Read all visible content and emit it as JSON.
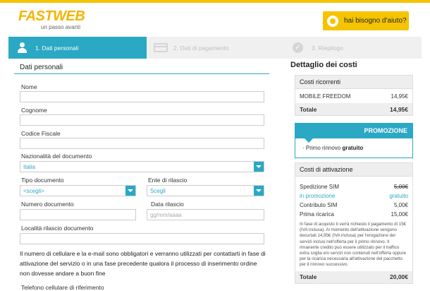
{
  "header": {
    "logo": "FASTWEB",
    "tagline": "un passo avanti",
    "help_label": "hai bisogno d'aiuto?"
  },
  "steps": [
    {
      "label": "1. Dati personali"
    },
    {
      "label": "2. Dati di pagamento"
    },
    {
      "label": "3. Riepilogo"
    }
  ],
  "form": {
    "section_title": "Dati personali",
    "nome_label": "Nome",
    "cognome_label": "Cognome",
    "codice_fiscale_label": "Codice Fiscale",
    "nazionalita_label": "Nazionalità del documento",
    "nazionalita_value": "Italia",
    "tipo_documento_label": "Tipo documento",
    "tipo_documento_value": "<scegli>",
    "ente_label": "Ente di rilascio",
    "ente_value": "Scegli",
    "numero_documento_label": "Numero documento",
    "data_rilascio_label": "Data rilascio",
    "data_rilascio_placeholder": "gg/mm/aaaa",
    "localita_label": "Località rilascio documento",
    "notice": "Il numero di cellulare e la e-mail sono obbligatori e verranno utilizzati per contattarti in fase di attivazione del servizio o in una fase precedente qualora il processo di inserimento ordine non dovesse andare a buon fine",
    "telefono_label": "Telefono cellulare di riferimento"
  },
  "sidebar": {
    "title": "Dettaglio dei costi",
    "ricorrenti": {
      "title": "Costi ricorrenti",
      "item_label": "MOBILE FREEDOM",
      "item_value": "14,95€",
      "total_label": "Totale",
      "total_value": "14,95€"
    },
    "promo": {
      "banner": "PROMOZIONE",
      "text_prefix": "Primo rinnovo",
      "text_bold": "gratuito"
    },
    "attivazione": {
      "title": "Costi di attivazione",
      "rows": [
        {
          "label": "Spedizione SIM",
          "value": "5,00€"
        },
        {
          "label": "in promozione",
          "value": "gratuito"
        },
        {
          "label": "Contributo SIM",
          "value": "5,00€"
        },
        {
          "label": "Prima ricarica",
          "value": "15,00€"
        }
      ],
      "fine_print": "In fase di acquisto ti verrà richiesto il pagamento di 15€ (IVA inclusa). Al momento dell'attivazione vengono decurtati 14,95€ (IVA inclusa) per l'erogazione dei servizi inclusi nell'offerta per il primo rinnovo. Il rimanente credito può essere utilizzato per il traffico extra soglia e/o servizi non contenuti nell'offerta oppure per la ricarica necessaria all'attivazione del pacchetto per il rinnovo successivo.",
      "total_label": "Totale",
      "total_value": "20,00€"
    }
  },
  "colors": {
    "brand_yellow": "#f5c400",
    "accent_blue": "#2aa8c4"
  }
}
